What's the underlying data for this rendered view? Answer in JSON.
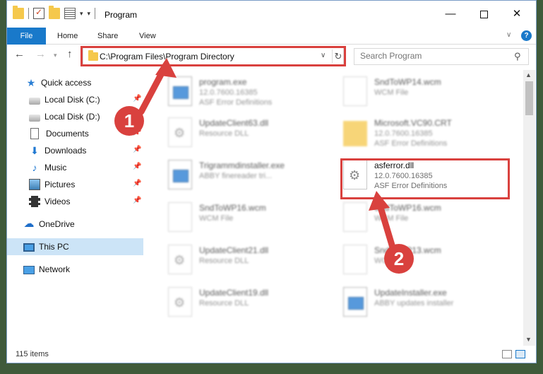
{
  "window": {
    "title": "Program",
    "min_glyph": "—",
    "close_glyph": "✕"
  },
  "ribbon": {
    "tabs": [
      "File",
      "Home",
      "Share",
      "View"
    ],
    "help": "?"
  },
  "address": {
    "path": "C:\\Program Files\\Program Directory"
  },
  "search": {
    "placeholder": "Search Program"
  },
  "sidebar": {
    "items": [
      {
        "label": "Quick access",
        "icon": "star-icon"
      },
      {
        "label": "Local Disk (C:)",
        "icon": "disk-icon",
        "pinned": true
      },
      {
        "label": "Local Disk (D:)",
        "icon": "disk-icon",
        "pinned": true
      },
      {
        "label": "Documents",
        "icon": "document-icon",
        "pinned": true
      },
      {
        "label": "Downloads",
        "icon": "download-icon",
        "pinned": true
      },
      {
        "label": "Music",
        "icon": "music-icon",
        "pinned": true
      },
      {
        "label": "Pictures",
        "icon": "pictures-icon",
        "pinned": true
      },
      {
        "label": "Videos",
        "icon": "videos-icon",
        "pinned": true
      },
      {
        "label": "OneDrive",
        "icon": "cloud-icon"
      },
      {
        "label": "This PC",
        "icon": "computer-icon",
        "selected": true
      },
      {
        "label": "Network",
        "icon": "network-icon"
      }
    ]
  },
  "files": [
    {
      "name": "program.exe",
      "version": "12.0.7600.16385",
      "desc": "ASF Error Definitions",
      "type": "exe"
    },
    {
      "name": "SndToWP14.wcm",
      "version": "WCM File",
      "desc": "",
      "type": "blank"
    },
    {
      "name": "UpdateClient63.dll",
      "version": "Resource DLL",
      "desc": "",
      "type": "dll"
    },
    {
      "name": "Microsoft.VC90.CRT",
      "version": "12.0.7600.16385",
      "desc": "ASF Error Definitions",
      "type": "folder"
    },
    {
      "name": "Trigrammdinstaller.exe",
      "version": "ABBY finereader tri...",
      "desc": "",
      "type": "exe"
    },
    {
      "name": "asferror.dll",
      "version": "12.0.7600.16385",
      "desc": "ASF Error Definitions",
      "type": "dll",
      "highlighted": true
    },
    {
      "name": "SndToWP16.wcm",
      "version": "WCM File",
      "desc": "",
      "type": "blank"
    },
    {
      "name": "SndToWP16.wcm",
      "version": "WCM File",
      "desc": "",
      "type": "blank"
    },
    {
      "name": "UpdateClient21.dll",
      "version": "Resource DLL",
      "desc": "",
      "type": "dll"
    },
    {
      "name": "SndToWP13.wcm",
      "version": "WCM File",
      "desc": "",
      "type": "blank"
    },
    {
      "name": "UpdateClient19.dll",
      "version": "Resource DLL",
      "desc": "",
      "type": "dll"
    },
    {
      "name": "UpdateInstaller.exe",
      "version": "ABBY updates installer",
      "desc": "",
      "type": "exe"
    }
  ],
  "status": {
    "count": "115 items"
  },
  "annotations": {
    "step1": "1",
    "step2": "2",
    "color": "#d9413e"
  }
}
